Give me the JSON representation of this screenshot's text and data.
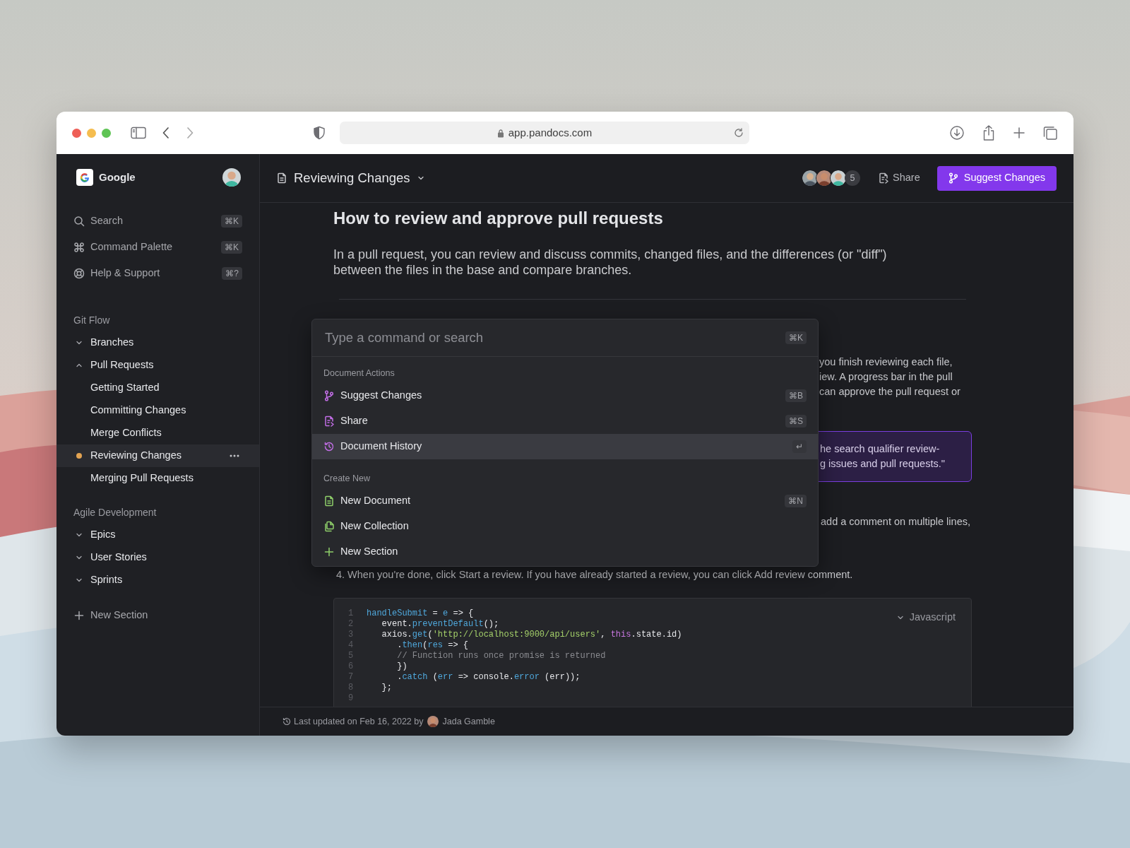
{
  "browser": {
    "url": "app.pandocs.com"
  },
  "sidebar": {
    "workspace": "Google",
    "nav": [
      {
        "kind": "search",
        "label": "Search",
        "shortcut": "⌘K"
      },
      {
        "kind": "command",
        "label": "Command Palette",
        "shortcut": "⌘K"
      },
      {
        "kind": "help",
        "label": "Help & Support",
        "shortcut": "⌘?"
      }
    ],
    "sections": [
      {
        "title": "Git Flow",
        "items": [
          {
            "label": "Branches",
            "expanded": false
          },
          {
            "label": "Pull Requests",
            "expanded": true,
            "children": [
              {
                "label": "Getting Started",
                "selected": false
              },
              {
                "label": "Committing Changes",
                "selected": false
              },
              {
                "label": "Merge Conflicts",
                "selected": false
              },
              {
                "label": "Reviewing Changes",
                "selected": true
              },
              {
                "label": "Merging Pull Requests",
                "selected": false
              }
            ]
          }
        ]
      },
      {
        "title": "Agile Development",
        "items": [
          {
            "label": "Epics",
            "expanded": false
          },
          {
            "label": "User Stories",
            "expanded": false
          },
          {
            "label": "Sprints",
            "expanded": false
          }
        ]
      }
    ],
    "new_section": "New Section"
  },
  "header": {
    "title": "Reviewing Changes",
    "collaborator_count": "5",
    "share": "Share",
    "suggest": "Suggest Changes"
  },
  "document": {
    "heading": "How to review and approve pull requests",
    "intro": "In a pull request, you can review and discuss commits, changed files, and the differences (or \"diff\") between the files in the base and compare branches.",
    "fragments": [
      "you finish reviewing each file,",
      "iew. A progress bar in the pull",
      "can approve the pull request or"
    ],
    "callout": [
      "he search qualifier review-",
      "g issues and pull requests.\""
    ],
    "fragment_2": "add a comment on multiple lines,",
    "step": "4. When you're done, click Start a review. If you have already started a review, you can click Add review comment.",
    "code": {
      "language": "Javascript",
      "lines": [
        {
          "number": "1",
          "tokens": [
            {
              "text": "handleSubmit",
              "kind": "name"
            },
            {
              "text": " = ",
              "kind": "plain"
            },
            {
              "text": "e",
              "kind": "name"
            },
            {
              "text": " => {",
              "kind": "plain"
            }
          ]
        },
        {
          "number": "2",
          "tokens": [
            {
              "text": "   event.",
              "kind": "plain"
            },
            {
              "text": "preventDefault",
              "kind": "name"
            },
            {
              "text": "();",
              "kind": "plain"
            }
          ]
        },
        {
          "number": "3",
          "tokens": [
            {
              "text": "   axios.",
              "kind": "plain"
            },
            {
              "text": "get",
              "kind": "name"
            },
            {
              "text": "(",
              "kind": "plain"
            },
            {
              "text": "'http://localhost:9000/api/users'",
              "kind": "string"
            },
            {
              "text": ", ",
              "kind": "plain"
            },
            {
              "text": "this",
              "kind": "keyword"
            },
            {
              "text": ".state.id)",
              "kind": "plain"
            }
          ]
        },
        {
          "number": "4",
          "tokens": [
            {
              "text": "      .",
              "kind": "plain"
            },
            {
              "text": "then",
              "kind": "name"
            },
            {
              "text": "(",
              "kind": "plain"
            },
            {
              "text": "res",
              "kind": "name"
            },
            {
              "text": " => {",
              "kind": "plain"
            }
          ]
        },
        {
          "number": "5",
          "tokens": [
            {
              "text": "      // Function runs once promise is returned",
              "kind": "comment"
            }
          ]
        },
        {
          "number": "6",
          "tokens": [
            {
              "text": "      })",
              "kind": "plain"
            }
          ]
        },
        {
          "number": "7",
          "tokens": [
            {
              "text": "      .",
              "kind": "plain"
            },
            {
              "text": "catch",
              "kind": "name"
            },
            {
              "text": " (",
              "kind": "plain"
            },
            {
              "text": "err",
              "kind": "name"
            },
            {
              "text": " => console.",
              "kind": "plain"
            },
            {
              "text": "error",
              "kind": "name"
            },
            {
              "text": " (err));",
              "kind": "plain"
            }
          ]
        },
        {
          "number": "8",
          "tokens": [
            {
              "text": "   };",
              "kind": "plain"
            }
          ]
        },
        {
          "number": "9"
        }
      ]
    }
  },
  "palette": {
    "placeholder": "Type a command or search",
    "shortcut": "⌘K",
    "groups": [
      {
        "title": "Document Actions",
        "items": [
          {
            "kind": "branch",
            "label": "Suggest Changes",
            "shortcut": "⌘B",
            "selected": false
          },
          {
            "kind": "share",
            "label": "Share",
            "shortcut": "⌘S",
            "selected": false
          },
          {
            "kind": "history",
            "label": "Document History",
            "shortcut": "↵",
            "selected": true
          }
        ]
      },
      {
        "title": "Create New",
        "items": [
          {
            "kind": "document",
            "label": "New Document",
            "shortcut": "⌘N",
            "selected": false
          },
          {
            "kind": "collection",
            "label": "New Collection",
            "selected": false
          },
          {
            "kind": "plus",
            "label": "New Section",
            "selected": false
          }
        ]
      }
    ]
  },
  "footer": {
    "text": "Last updated on Feb 16, 2022 by",
    "author": "Jada Gamble"
  }
}
